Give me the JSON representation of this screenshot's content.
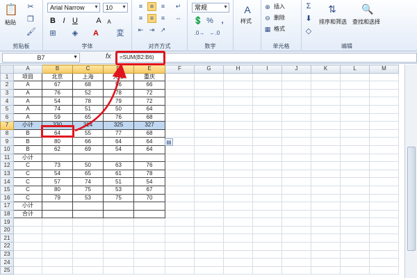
{
  "ribbon": {
    "clipboard": {
      "paste": "粘贴",
      "group": "剪贴板"
    },
    "font": {
      "name": "Arial Narrow",
      "size": "10",
      "bold": "B",
      "italic": "I",
      "underline": "U",
      "grow": "A",
      "shrink": "A",
      "group": "字体"
    },
    "alignment": {
      "group": "对齐方式"
    },
    "number": {
      "format": "常规",
      "percent": "%",
      "comma": ",",
      "group": "数字"
    },
    "styles": {
      "label": "样式"
    },
    "cells": {
      "insert": "插入",
      "delete": "删除",
      "format": "格式",
      "group": "单元格"
    },
    "editing": {
      "sigma": "Σ",
      "sort": "排序和筛选",
      "find": "查找和选择",
      "group": "编辑"
    }
  },
  "formula_bar": {
    "name_box": "B7",
    "fx": "fx",
    "formula": "=SUM(B2:B6)"
  },
  "sheet": {
    "columns": [
      "A",
      "B",
      "C",
      "D",
      "E",
      "F",
      "G",
      "H",
      "I",
      "J",
      "K",
      "L",
      "M"
    ],
    "selected_row": 7,
    "rows": [
      {
        "n": "1",
        "cells": [
          "项目",
          "北京",
          "上海",
          "天津",
          "重庆"
        ]
      },
      {
        "n": "2",
        "cells": [
          "A",
          "67",
          "68",
          "56",
          "66"
        ]
      },
      {
        "n": "3",
        "cells": [
          "A",
          "76",
          "52",
          "78",
          "72"
        ]
      },
      {
        "n": "4",
        "cells": [
          "A",
          "54",
          "78",
          "79",
          "72"
        ]
      },
      {
        "n": "5",
        "cells": [
          "A",
          "74",
          "51",
          "50",
          "64"
        ]
      },
      {
        "n": "6",
        "cells": [
          "A",
          "59",
          "65",
          "76",
          "68"
        ]
      },
      {
        "n": "7",
        "cells": [
          "小计",
          "330",
          "314",
          "325",
          "327"
        ]
      },
      {
        "n": "8",
        "cells": [
          "B",
          "64",
          "55",
          "77",
          "68"
        ]
      },
      {
        "n": "9",
        "cells": [
          "B",
          "80",
          "66",
          "64",
          "64"
        ]
      },
      {
        "n": "10",
        "cells": [
          "B",
          "62",
          "69",
          "54",
          "64"
        ]
      },
      {
        "n": "11",
        "cells": [
          "小计",
          "",
          "",
          "",
          ""
        ]
      },
      {
        "n": "12",
        "cells": [
          "C",
          "73",
          "50",
          "63",
          "76"
        ]
      },
      {
        "n": "13",
        "cells": [
          "C",
          "54",
          "65",
          "61",
          "78"
        ]
      },
      {
        "n": "14",
        "cells": [
          "C",
          "57",
          "74",
          "51",
          "54"
        ]
      },
      {
        "n": "15",
        "cells": [
          "C",
          "80",
          "75",
          "53",
          "67"
        ]
      },
      {
        "n": "16",
        "cells": [
          "C",
          "79",
          "53",
          "75",
          "70"
        ]
      },
      {
        "n": "17",
        "cells": [
          "小计",
          "",
          "",
          "",
          ""
        ]
      },
      {
        "n": "18",
        "cells": [
          "合计",
          "",
          "",
          "",
          ""
        ]
      },
      {
        "n": "19",
        "cells": [
          "",
          "",
          "",
          "",
          ""
        ]
      },
      {
        "n": "20",
        "cells": [
          "",
          "",
          "",
          "",
          ""
        ]
      },
      {
        "n": "21",
        "cells": [
          "",
          "",
          "",
          "",
          ""
        ]
      },
      {
        "n": "22",
        "cells": [
          "",
          "",
          "",
          "",
          ""
        ]
      },
      {
        "n": "23",
        "cells": [
          "",
          "",
          "",
          "",
          ""
        ]
      },
      {
        "n": "24",
        "cells": [
          "",
          "",
          "",
          "",
          ""
        ]
      },
      {
        "n": "25",
        "cells": [
          "",
          "",
          "",
          "",
          ""
        ]
      }
    ]
  },
  "colors": {
    "highlight": "#e0141e",
    "selected_row": "#bfd7f0"
  }
}
